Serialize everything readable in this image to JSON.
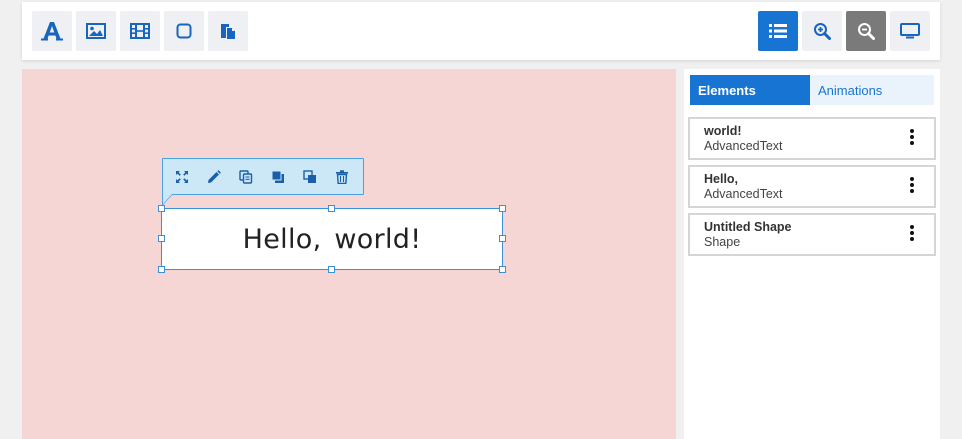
{
  "toolbar": {
    "left_tools": [
      {
        "icon": "text-tool-icon"
      },
      {
        "icon": "image-tool-icon"
      },
      {
        "icon": "video-tool-icon"
      },
      {
        "icon": "shape-tool-icon"
      },
      {
        "icon": "paste-tool-icon"
      }
    ],
    "right_tools": [
      {
        "icon": "elements-list-icon",
        "state": "active"
      },
      {
        "icon": "zoom-in-icon"
      },
      {
        "icon": "zoom-out-icon",
        "state": "pressed"
      },
      {
        "icon": "preview-monitor-icon"
      }
    ]
  },
  "canvas": {
    "background_color": "#f6d6d5",
    "selected_text": "Hello,  world!",
    "float_toolbar": [
      {
        "icon": "expand-icon"
      },
      {
        "icon": "edit-icon"
      },
      {
        "icon": "duplicate-icon"
      },
      {
        "icon": "bring-forward-icon"
      },
      {
        "icon": "send-backward-icon"
      },
      {
        "icon": "delete-icon"
      }
    ]
  },
  "panel": {
    "tabs": [
      {
        "label": "Elements",
        "active": true
      },
      {
        "label": "Animations",
        "active": false
      }
    ],
    "elements": [
      {
        "title": "world!",
        "type": "AdvancedText"
      },
      {
        "title": "Hello,",
        "type": "AdvancedText"
      },
      {
        "title": "Untitled Shape",
        "type": "Shape"
      }
    ]
  },
  "colors": {
    "accent": "#1874d2",
    "selection": "#3a91d6",
    "toolbar_button_bg": "#eef0f3"
  }
}
